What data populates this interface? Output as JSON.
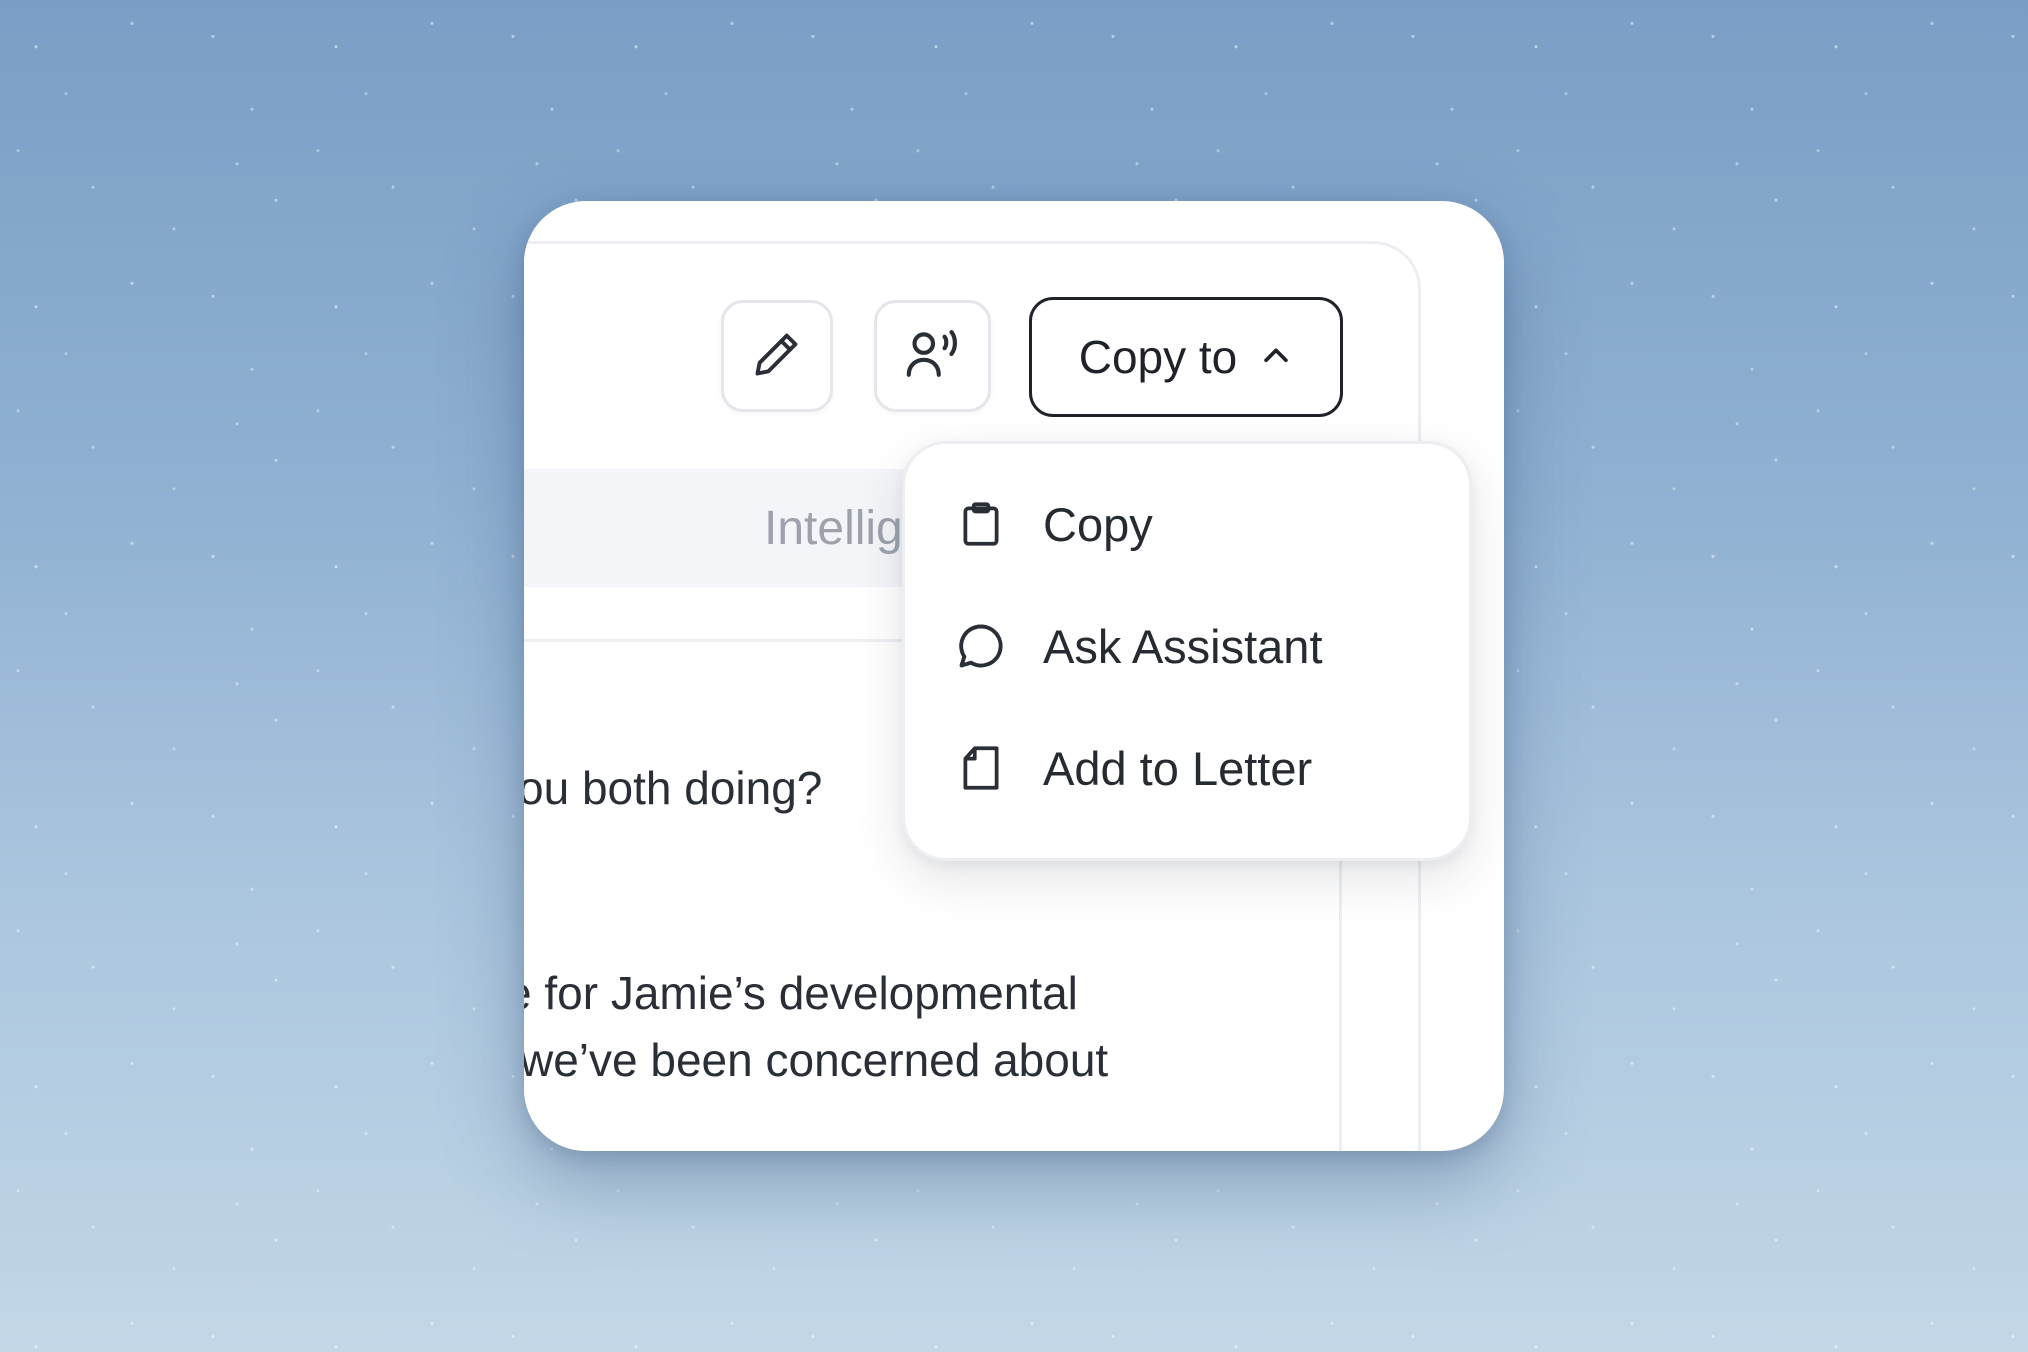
{
  "toolbar": {
    "edit_icon": "pencil-icon",
    "voice_icon": "voice-person-icon",
    "copy_to_label": "Copy to",
    "copy_to_chevron": "chevron-up-icon"
  },
  "tabs": {
    "active_label": "Intellig"
  },
  "transcript": {
    "lines": [
      "ou both doing?",
      "e for Jamie’s developmental",
      "we’ve been concerned about"
    ]
  },
  "menu": {
    "items": [
      {
        "label": "Copy",
        "icon": "clipboard-icon"
      },
      {
        "label": "Ask Assistant",
        "icon": "chat-bubble-icon"
      },
      {
        "label": "Add to Letter",
        "icon": "document-icon"
      }
    ]
  },
  "colors": {
    "background_top": "#7a9ec5",
    "background_bottom": "#c3d7e7",
    "text_primary": "#1f2329",
    "text_muted": "#9da2ad",
    "border": "#e4e6eb"
  }
}
